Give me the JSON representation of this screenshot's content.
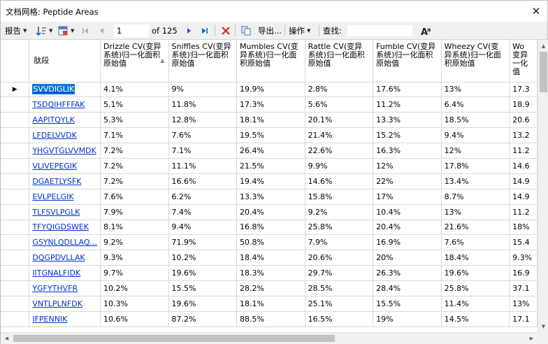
{
  "window": {
    "title": "文档网格: Peptide Areas",
    "close_glyph": "✕"
  },
  "toolbar": {
    "report_label": "报告",
    "dropdown_glyph": "▼",
    "position_value": "1",
    "of_label": "of 125",
    "export_label": "导出...",
    "actions_label": "操作",
    "find_label": "查找:",
    "find_value": ""
  },
  "colors": {
    "accent": "#0a78d7",
    "link": "#0033cc",
    "delete": "#e02020",
    "nav": "#1565c0"
  },
  "grid": {
    "columns": [
      "肽段",
      "Drizzle CV(变异系统)归一化面积原始值",
      "Sniffles CV(变异系统)归一化面积原始值",
      "Mumbles CV(变异系统)归一化面积原始值",
      "Rattle CV(变异系统)归一化面积原始值",
      "Fumble CV(变异系统)归一化面积原始值",
      "Wheezy CV(变异系统)归一化面积原始值",
      "Wo 变异一化值"
    ],
    "sort_glyph": "▲",
    "current_row_glyph": "▶",
    "rows": [
      {
        "peptide": "SVVDIGLIK",
        "vals": [
          "4.1%",
          "9%",
          "19.9%",
          "2.8%",
          "17.6%",
          "13%",
          "17.3"
        ]
      },
      {
        "peptide": "TSDQIHFFFAK",
        "vals": [
          "5.1%",
          "11.8%",
          "17.3%",
          "5.6%",
          "11.2%",
          "6.4%",
          "18.9"
        ]
      },
      {
        "peptide": "AAPITQYLK",
        "vals": [
          "5.3%",
          "12.8%",
          "18.1%",
          "20.1%",
          "13.3%",
          "18.5%",
          "20.6"
        ]
      },
      {
        "peptide": "LFDELVVDK",
        "vals": [
          "7.1%",
          "7.6%",
          "19.5%",
          "21.4%",
          "15.2%",
          "9.4%",
          "13.2"
        ]
      },
      {
        "peptide": "YHGVTGLVVMDK",
        "vals": [
          "7.2%",
          "7.1%",
          "26.4%",
          "22.6%",
          "16.3%",
          "12%",
          "11.2"
        ]
      },
      {
        "peptide": "VLIVEPEGIK",
        "vals": [
          "7.2%",
          "11.1%",
          "21.5%",
          "9.9%",
          "12%",
          "17.8%",
          "14.6"
        ]
      },
      {
        "peptide": "DGAETLYSFK",
        "vals": [
          "7.2%",
          "16.6%",
          "19.4%",
          "14.6%",
          "22%",
          "13.4%",
          "14.9"
        ]
      },
      {
        "peptide": "EVLPELGIK",
        "vals": [
          "7.6%",
          "6.2%",
          "13.3%",
          "15.8%",
          "17%",
          "8.7%",
          "14.9"
        ]
      },
      {
        "peptide": "TLFSVLPGLK",
        "vals": [
          "7.9%",
          "7.4%",
          "20.4%",
          "9.2%",
          "10.4%",
          "13%",
          "11.2"
        ]
      },
      {
        "peptide": "TFYQIGDSWEK",
        "vals": [
          "8.1%",
          "9.4%",
          "16.8%",
          "25.8%",
          "20.4%",
          "21.6%",
          "18%"
        ]
      },
      {
        "peptide": "GSYNLQDLLAQ...",
        "vals": [
          "9.2%",
          "71.9%",
          "50.8%",
          "7.9%",
          "16.9%",
          "7.6%",
          "15.4"
        ]
      },
      {
        "peptide": "DQGPDVLLAK",
        "vals": [
          "9.3%",
          "10.2%",
          "18.4%",
          "20.6%",
          "20%",
          "18.4%",
          "9.3%"
        ]
      },
      {
        "peptide": "IITGNALFIDK",
        "vals": [
          "9.7%",
          "19.6%",
          "18.3%",
          "29.7%",
          "26.3%",
          "19.6%",
          "16.9"
        ]
      },
      {
        "peptide": "YGFYTHVFR",
        "vals": [
          "10.2%",
          "15.5%",
          "28.2%",
          "28.5%",
          "28.4%",
          "25.8%",
          "37.1"
        ]
      },
      {
        "peptide": "VNTLPLNFDK",
        "vals": [
          "10.3%",
          "19.6%",
          "18.1%",
          "25.1%",
          "15.5%",
          "11.4%",
          "13%"
        ]
      },
      {
        "peptide": "IFPENNIK",
        "vals": [
          "10.6%",
          "87.2%",
          "88.5%",
          "16.5%",
          "19%",
          "14.5%",
          "17.1"
        ]
      }
    ]
  }
}
